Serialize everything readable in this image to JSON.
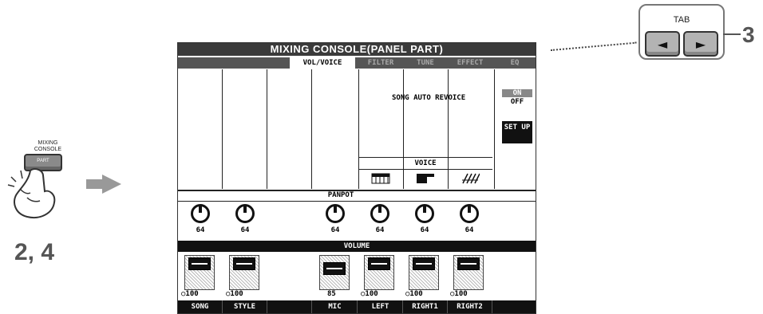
{
  "left_panel": {
    "button_label_line1": "MIXING",
    "button_label_line2": "CONSOLE",
    "button_face_text": "PART",
    "step_label": "2, 4"
  },
  "tab_box": {
    "label": "TAB",
    "prev_glyph": "◄",
    "next_glyph": "►",
    "step_label": "3"
  },
  "screen": {
    "title": "MIXING CONSOLE(PANEL PART)",
    "tabs": [
      "VOL/VOICE",
      "FILTER",
      "TUNE",
      "EFFECT",
      "EQ"
    ],
    "active_tab": "VOL/VOICE",
    "song_auto_revoice_label": "SONG AUTO REVOICE",
    "toggle_on": "ON",
    "toggle_off": "OFF",
    "setup_label": "SET UP",
    "voice_label": "VOICE",
    "panpot_label": "PANPOT",
    "volume_label": "VOLUME",
    "panpot_values": [
      "64",
      "64",
      "64",
      "64",
      "64",
      "64"
    ],
    "volume_values": [
      "100",
      "100",
      "85",
      "100",
      "100",
      "100"
    ],
    "channels": [
      "SONG",
      "STYLE",
      "",
      "MIC",
      "LEFT",
      "RIGHT1",
      "RIGHT2"
    ],
    "voice_icons": [
      "keyboard-icon",
      "organ-icon",
      "strings-icon"
    ]
  }
}
